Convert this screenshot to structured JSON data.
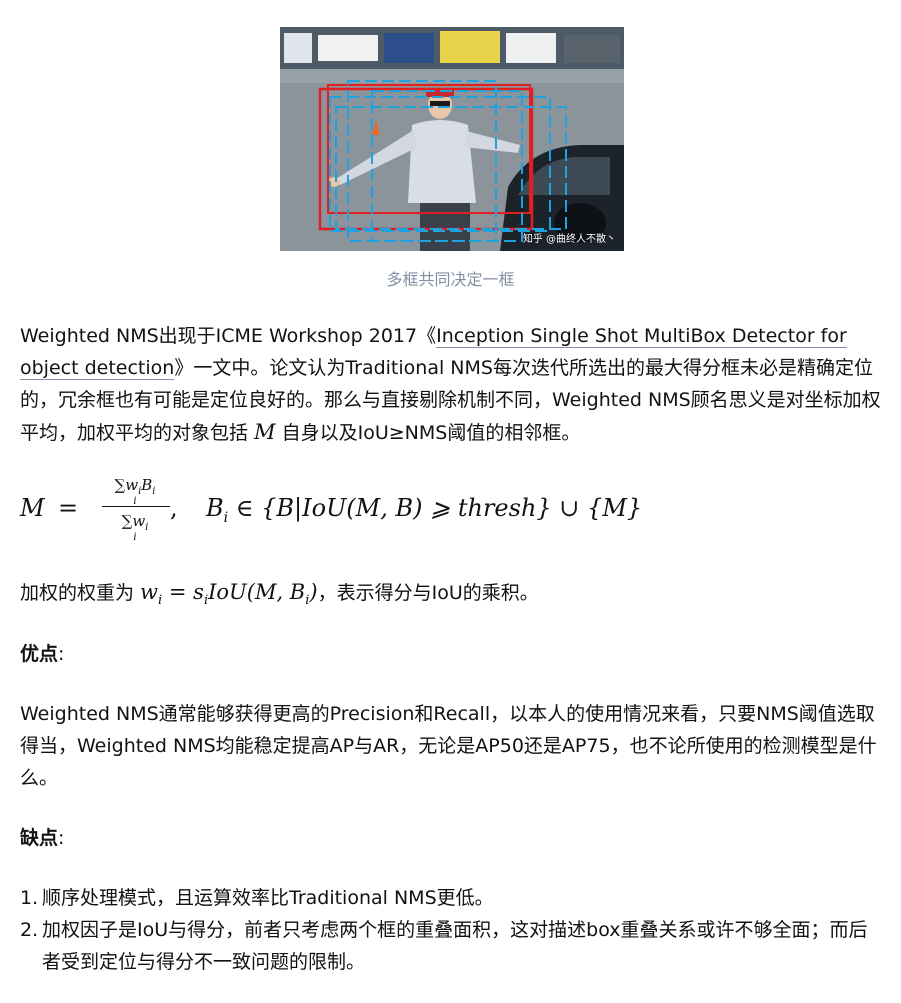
{
  "figure": {
    "watermark": "知乎 @曲终人不散丶",
    "caption": "多框共同决定一框",
    "box_colors": {
      "red": "#e02020",
      "cyan": "#1fa3e0"
    }
  },
  "paragraph1": {
    "text_a": "Weighted NMS出现于ICME Workshop 2017《",
    "link_text": "Inception Single Shot MultiBox Detector for object detection",
    "text_b": "》一文中。论文认为Traditional NMS每次迭代所选出的最大得分框未必是精确定位的，冗余框也有可能是定位良好的。那么与直接剔除机制不同，Weighted NMS顾名思义是对坐标加权平均，加权平均的对象包括 ",
    "math": "M",
    "text_c": " 自身以及IoU≥NMS阈值的相邻框。"
  },
  "formula": {
    "lhs": "M",
    "eq": "=",
    "numerator": "w",
    "numerator_tail": "B",
    "sum_sub": "i",
    "denominator": "w",
    "comma": ",",
    "rhs": "B",
    "rhs_tail": " ∈ {B|IoU(M, B) ⩾ thresh} ∪ {M}"
  },
  "paragraph2": {
    "text_a": "加权的权重为 ",
    "math": "w",
    "math_tail": " = s",
    "math_tail2": "IoU(M, B",
    "math_tail3": ")",
    "text_b": "，表示得分与IoU的乘积。"
  },
  "pros": {
    "heading": "优点",
    "colon": ":",
    "text": "Weighted NMS通常能够获得更高的Precision和Recall，以本人的使用情况来看，只要NMS阈值选取得当，Weighted NMS均能稳定提高AP与AR，无论是AP50还是AP75，也不论所使用的检测模型是什么。"
  },
  "cons": {
    "heading": "缺点",
    "colon": ":",
    "items": [
      {
        "num": "1.",
        "text": "顺序处理模式，且运算效率比Traditional NMS更低。"
      },
      {
        "num": "2.",
        "text": "加权因子是IoU与得分，前者只考虑两个框的重叠面积，这对描述box重叠关系或许不够全面；而后者受到定位与得分不一致问题的限制。"
      }
    ]
  }
}
